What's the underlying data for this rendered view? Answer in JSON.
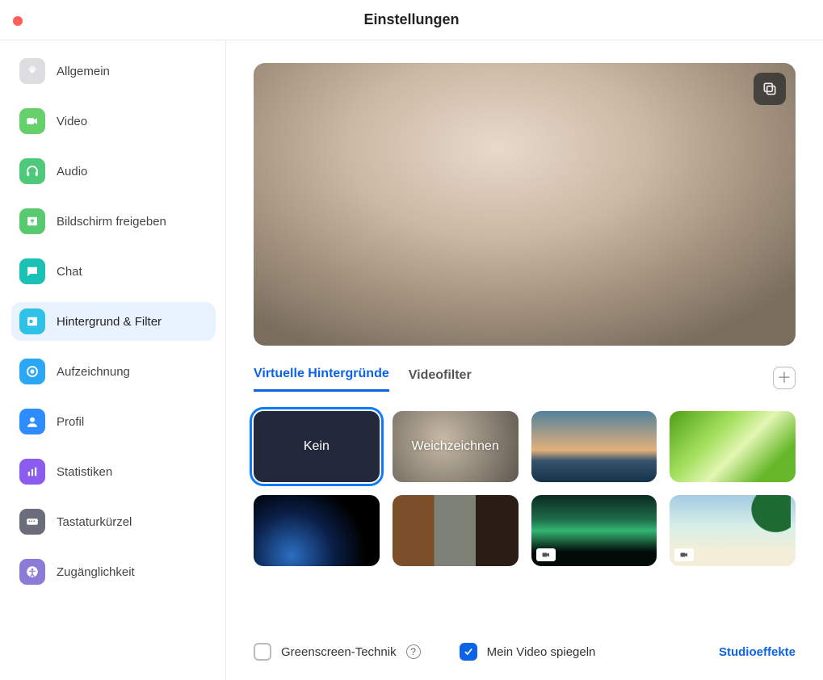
{
  "window": {
    "title": "Einstellungen"
  },
  "sidebar": {
    "items": [
      {
        "label": "Allgemein"
      },
      {
        "label": "Video"
      },
      {
        "label": "Audio"
      },
      {
        "label": "Bildschirm freigeben"
      },
      {
        "label": "Chat"
      },
      {
        "label": "Hintergrund & Filter"
      },
      {
        "label": "Aufzeichnung"
      },
      {
        "label": "Profil"
      },
      {
        "label": "Statistiken"
      },
      {
        "label": "Tastaturkürzel"
      },
      {
        "label": "Zugänglichkeit"
      }
    ],
    "selected_index": 5
  },
  "tabs": {
    "virtual_backgrounds": "Virtuelle Hintergründe",
    "video_filter": "Videofilter",
    "active": "virtual_backgrounds"
  },
  "thumbs": {
    "none": "Kein",
    "blur": "Weichzeichnen",
    "selected": "none"
  },
  "options": {
    "greenscreen_label": "Greenscreen-Technik",
    "greenscreen_checked": false,
    "mirror_label": "Mein Video spiegeln",
    "mirror_checked": true
  },
  "studio_effects": "Studioeffekte"
}
